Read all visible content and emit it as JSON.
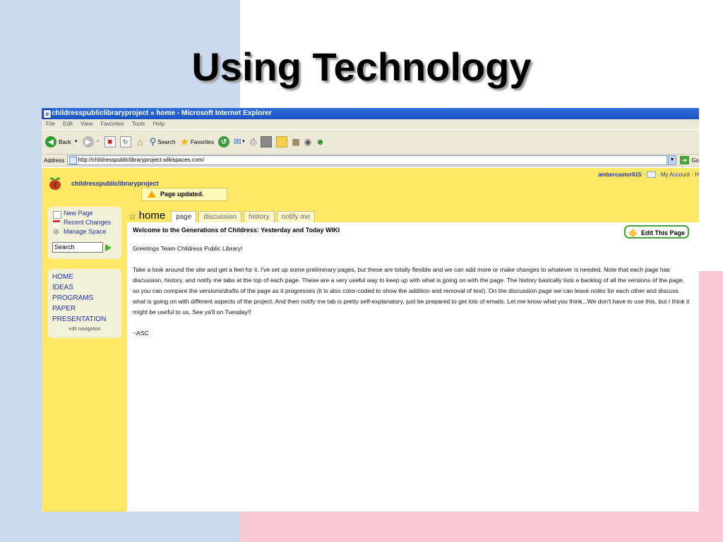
{
  "slide": {
    "title": "Using Technology"
  },
  "browser": {
    "window_title": "childresspubliclibraryproject » home - Microsoft Internet Explorer",
    "menu": [
      "File",
      "Edit",
      "View",
      "Favorites",
      "Tools",
      "Help"
    ],
    "toolbar": {
      "back": "Back",
      "search": "Search",
      "favorites": "Favorites"
    },
    "address_label": "Address",
    "url": "http://childresspubliclibraryproject.wikispaces.com/",
    "go_label": "Go"
  },
  "site": {
    "name": "childresspubliclibraryproject",
    "user": "ambercastor615",
    "my_account": "My Account",
    "notice": "Page updated."
  },
  "sidebar": {
    "tools": [
      {
        "label": "New Page",
        "icon": "new-page-icon"
      },
      {
        "label": "Recent Changes",
        "icon": "calendar-icon"
      },
      {
        "label": "Manage Space",
        "icon": "gear-icon"
      }
    ],
    "search_value": "Search",
    "nav": [
      "HOME",
      "IDEAS",
      "PROGRAMS",
      "PAPER",
      "PRESENTATION"
    ],
    "edit_nav": "edit navigation"
  },
  "tabs": {
    "home": "home",
    "items": [
      "page",
      "discussion",
      "history",
      "notify me"
    ]
  },
  "content": {
    "heading": "Welcome to the Generations of Childress: Yesterday and Today WIKI",
    "edit_button": "Edit This Page",
    "greeting": "Greetings Team Childress Public Library!",
    "body": "Take a look around the site and get a feel for it. I've set up some preliminary pages, but these are totally flexible and we can add more or make changes to whatever is needed. Note that each page has discussion, history, and notify me tabs at the top of each page. These are a very useful way to keep up with what is going on with the page. The history basically lists a backlog of all the versions of the page, so you can compare the versions/drafts of the page as it progresses (it is also color-coded to show the addition and removal of text). On the discussion page we can leave notes for each other and discuss what is going on with different aspects of the project. And then notify me tab is pretty self-explanatory, just be prepared to get lots of emails. Let me know what you think...We don't have to use this, but I think it might be useful to us. See ya'll on Tuesday!!",
    "signature": "~ASC"
  }
}
